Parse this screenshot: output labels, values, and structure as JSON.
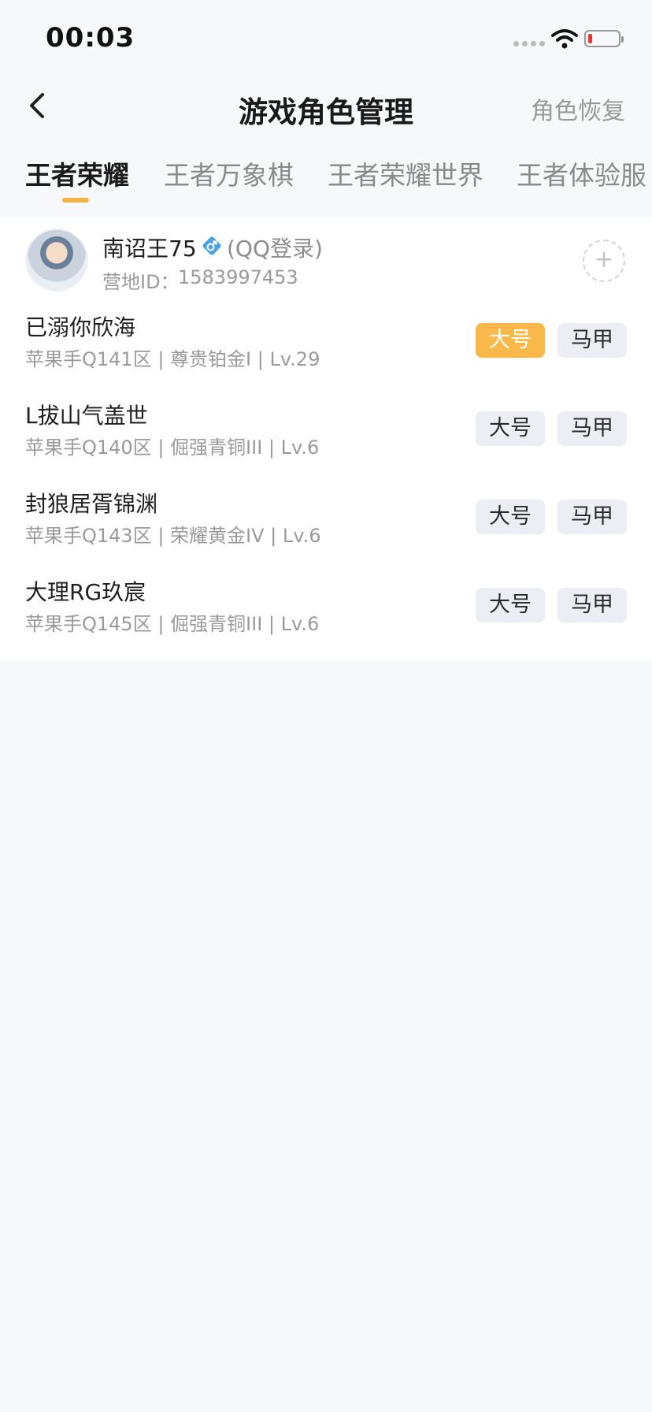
{
  "status_bar": {
    "time": "00:03"
  },
  "nav": {
    "title": "游戏角色管理",
    "restore_label": "角色恢复"
  },
  "tabs": [
    {
      "label": "王者荣耀"
    },
    {
      "label": "王者万象棋"
    },
    {
      "label": "王者荣耀世界"
    },
    {
      "label": "王者体验服"
    }
  ],
  "profile": {
    "name": "南诏王75",
    "login_type": "(QQ登录)",
    "camp_label": "营地ID：",
    "camp_id": "1583997453",
    "add_label": "+"
  },
  "roles": [
    {
      "name": "已溺你欣海",
      "detail": "苹果手Q141区 | 尊贵铂金I | Lv.29",
      "main_label": "大号",
      "alt_label": "马甲",
      "selected": "大号"
    },
    {
      "name": "L拔山气盖世",
      "detail": "苹果手Q140区 | 倔强青铜III | Lv.6",
      "main_label": "大号",
      "alt_label": "马甲"
    },
    {
      "name": "封狼居胥锦渊",
      "detail": "苹果手Q143区 | 荣耀黄金IV | Lv.6",
      "main_label": "大号",
      "alt_label": "马甲"
    },
    {
      "name": "大理RG玖宸",
      "detail": "苹果手Q145区 | 倔强青铜III | Lv.6",
      "main_label": "大号",
      "alt_label": "马甲"
    }
  ],
  "colors": {
    "accent": "#f9b94a",
    "tab_indicator": "#f5b344",
    "background": "#f7f8fa",
    "gender_icon": "#4aa3df"
  },
  "icons": {
    "back": "chevron-left-icon",
    "gender": "male-icon",
    "add": "plus-icon"
  }
}
